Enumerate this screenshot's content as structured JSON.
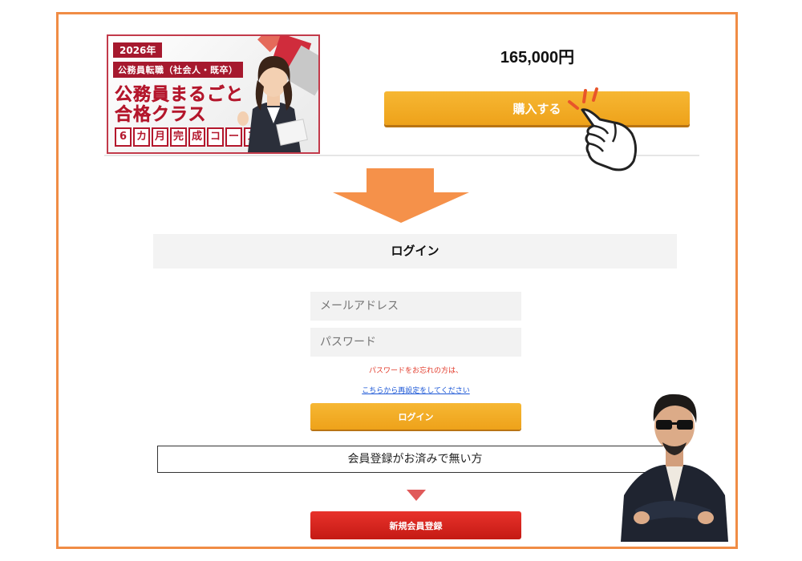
{
  "banner": {
    "year": "2026年",
    "subtitle": "公務員転職（社会人・既卒）",
    "title_line1": "公務員まるごと",
    "title_line2": "合格クラス",
    "course_chars": [
      "6",
      "カ",
      "月",
      "完",
      "成",
      "コ",
      "ー",
      "ス"
    ]
  },
  "product": {
    "price": "165,000円",
    "buy_label": "購入する"
  },
  "login": {
    "header": "ログイン",
    "email_placeholder": "メールアドレス",
    "password_placeholder": "パスワード",
    "forgot_text": "パスワードをお忘れの方は、",
    "reset_link": "こちらから再設定をしてください",
    "login_button": "ログイン"
  },
  "register": {
    "not_member_text": "会員登録がお済みで無い方",
    "register_button": "新規会員登録"
  },
  "colors": {
    "frame": "#f08c45",
    "button_orange": "#f6b733",
    "button_red": "#e8322b",
    "brand_red": "#b4172c"
  }
}
